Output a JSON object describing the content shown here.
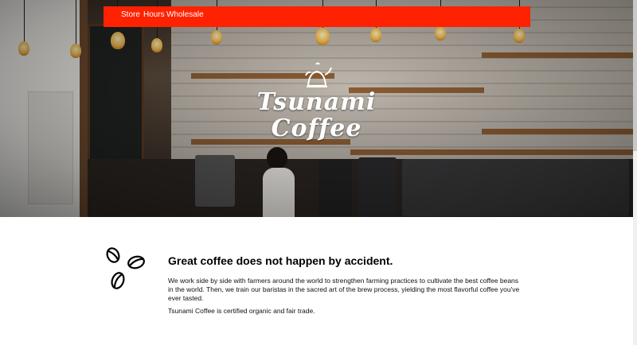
{
  "nav": {
    "links": [
      "Store",
      "Hours",
      "Wholesale"
    ]
  },
  "logo": {
    "line1": "Tsunami",
    "line2": "Coffee",
    "icon": "kettle-icon"
  },
  "content": {
    "icon": "coffee-beans-icon",
    "headline": "Great coffee does not happen by accident.",
    "paragraph1": "We work side by side with farmers around the world to strengthen farming practices to cultivate the best coffee beans in the world. Then, we train our baristas in the sacred art of the brew process, yielding the most flavorful coffee you've ever tasted.",
    "paragraph2": "Tsunami Coffee is certified organic and fair trade."
  },
  "colors": {
    "nav_bg": "#ff2200",
    "nav_text": "#ffffff",
    "body_bg": "#ffffff",
    "text": "#000000"
  }
}
